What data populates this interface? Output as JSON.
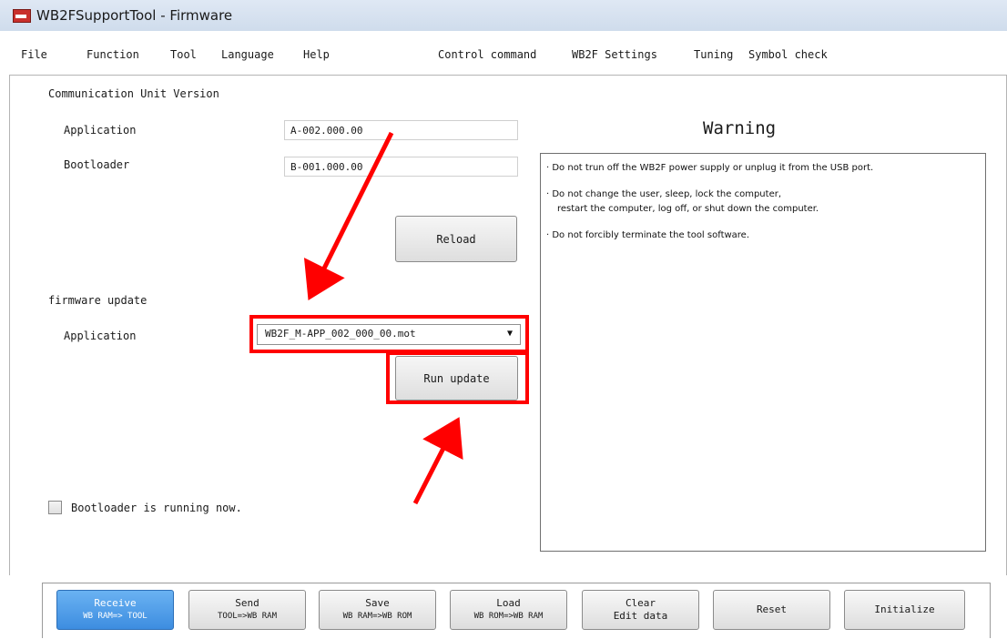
{
  "window": {
    "title": "WB2FSupportTool - Firmware"
  },
  "menu": {
    "left": [
      "File",
      "Function",
      "Tool",
      "Language",
      "Help"
    ],
    "right": [
      "Control command",
      "WB2F Settings",
      "Tuning",
      "Symbol check"
    ]
  },
  "version": {
    "heading": "Communication Unit Version",
    "application_label": "Application",
    "application_value": "A-002.000.00",
    "bootloader_label": "Bootloader",
    "bootloader_value": "B-001.000.00",
    "reload_label": "Reload"
  },
  "firmware": {
    "heading": "firmware update",
    "application_label": "Application",
    "selected_file": "WB2F_M-APP_002_000_00.mot",
    "run_update_label": "Run update"
  },
  "warning": {
    "title": "Warning",
    "lines": [
      "· Do not trun off the WB2F power supply or unplug it from the USB port.",
      "· Do not change the user, sleep, lock the computer,",
      "restart the computer, log off, or shut down the computer.",
      "· Do not forcibly terminate the tool software."
    ]
  },
  "bootloader_check": {
    "label": "Bootloader is running now.",
    "checked": false
  },
  "bottom_buttons": [
    {
      "line1": "Receive",
      "line2": "WB RAM=> TOOL",
      "active": true
    },
    {
      "line1": "Send",
      "line2": "TOOL=>WB RAM",
      "active": false
    },
    {
      "line1": "Save",
      "line2": "WB RAM=>WB ROM",
      "active": false
    },
    {
      "line1": "Load",
      "line2": "WB ROM=>WB RAM",
      "active": false
    },
    {
      "line1": "Clear",
      "line2": "Edit data",
      "active": false
    },
    {
      "line1": "Reset",
      "line2": "",
      "active": false
    },
    {
      "line1": "Initialize",
      "line2": "",
      "active": false
    }
  ],
  "colors": {
    "highlight": "#ff0000",
    "active_button": "#4a9be8",
    "title_bar": "#d6e1ef",
    "app_icon": "#c9302c"
  },
  "icons": [
    "app-icon",
    "dropdown-caret-icon",
    "checkbox-icon"
  ]
}
